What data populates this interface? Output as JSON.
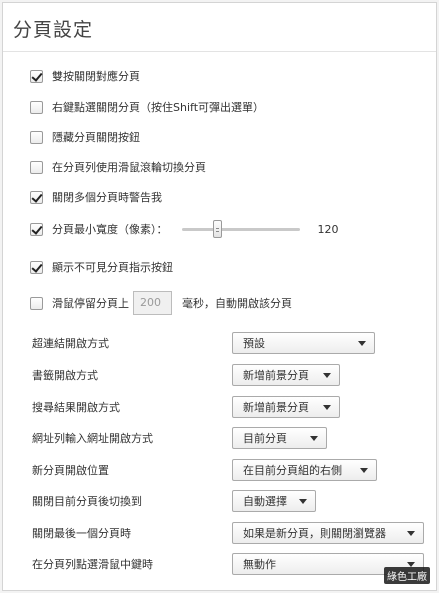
{
  "page": {
    "title": "分頁設定"
  },
  "options": [
    {
      "label": "雙按關閉對應分頁",
      "checked": true
    },
    {
      "label": "右鍵點選關閉分頁（按住Shift可彈出選單）",
      "checked": false
    },
    {
      "label": "隱藏分頁關閉按鈕",
      "checked": false
    },
    {
      "label": "在分頁列使用滑鼠滾輪切換分頁",
      "checked": false
    },
    {
      "label": "關閉多個分頁時警告我",
      "checked": true
    },
    {
      "label": "分頁最小寬度（像素）：",
      "checked": true
    },
    {
      "label": "顯示不可見分頁指示按鈕",
      "checked": true
    },
    {
      "label": "滑鼠停留分頁上",
      "checked": false
    }
  ],
  "min_width": {
    "value": "120",
    "slider_level": 0.28
  },
  "hover": {
    "value": "200",
    "suffix": "毫秒，自動開啟該分頁"
  },
  "selects": [
    {
      "label": "超連結開啟方式",
      "value": "預設"
    },
    {
      "label": "書籤開啟方式",
      "value": "新增前景分頁"
    },
    {
      "label": "搜尋結果開啟方式",
      "value": "新增前景分頁"
    },
    {
      "label": "網址列輸入網址開啟方式",
      "value": "目前分頁"
    },
    {
      "label": "新分頁開啟位置",
      "value": "在目前分頁組的右側"
    },
    {
      "label": "關閉目前分頁後切換到",
      "value": "自動選擇"
    },
    {
      "label": "關閉最後一個分頁時",
      "value": "如果是新分頁，則關閉瀏覽器"
    },
    {
      "label": "在分頁列點選滑鼠中鍵時",
      "value": "無動作"
    }
  ],
  "watermark": "綠色工廠"
}
